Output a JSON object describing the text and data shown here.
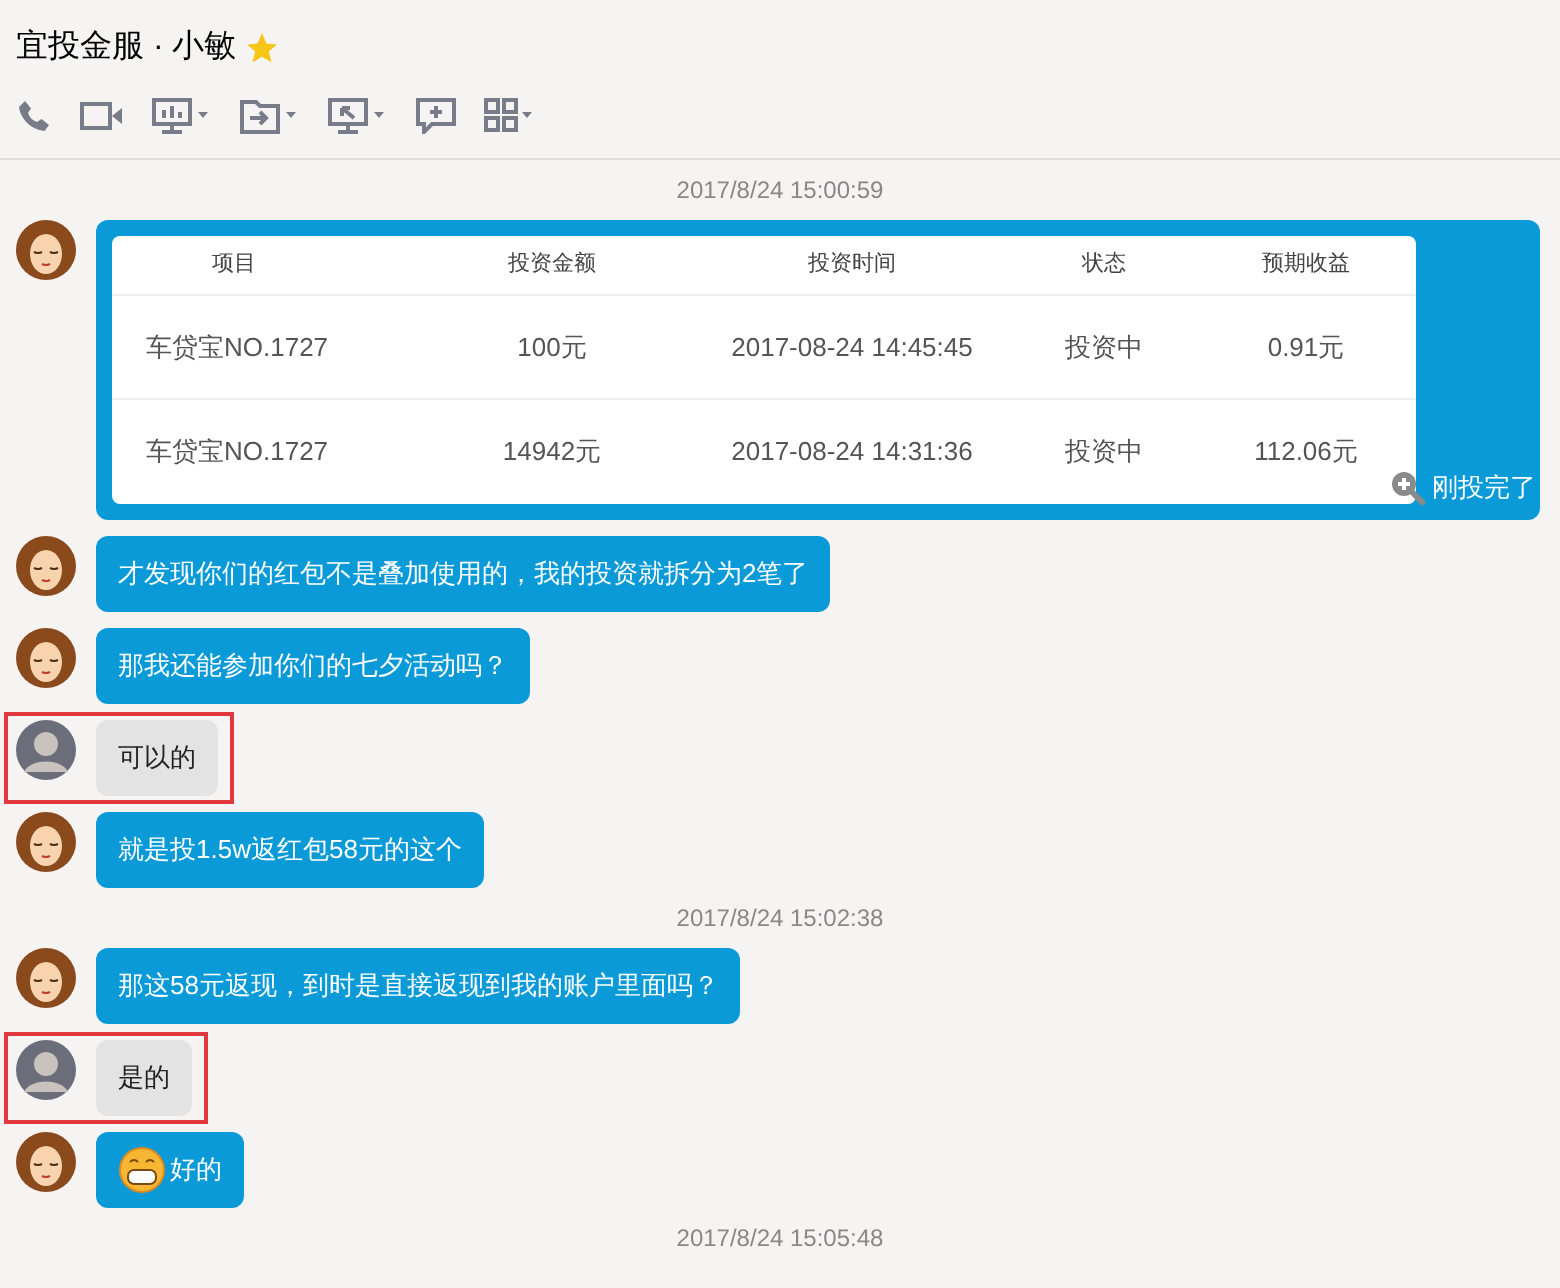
{
  "window": {
    "title": "宜投金服 · 小敏"
  },
  "messages": [
    {
      "kind": "timestamp",
      "text": "2017/8/24 15:00:59"
    },
    {
      "kind": "table",
      "columns": [
        "项目",
        "投资金额",
        "投资时间",
        "状态",
        "预期收益"
      ],
      "rows": [
        [
          "车贷宝NO.1727",
          "100元",
          "2017-08-24 14:45:45",
          "投资中",
          "0.91元"
        ],
        [
          "车贷宝NO.1727",
          "14942元",
          "2017-08-24 14:31:36",
          "投资中",
          "112.06元"
        ]
      ],
      "caption": "刚投完了"
    },
    {
      "kind": "sent",
      "highlighted": false,
      "text": "才发现你们的红包不是叠加使用的，我的投资就拆分为2笔了"
    },
    {
      "kind": "sent",
      "highlighted": false,
      "text": "那我还能参加你们的七夕活动吗？"
    },
    {
      "kind": "received",
      "highlighted": true,
      "text": "可以的"
    },
    {
      "kind": "sent",
      "highlighted": false,
      "text": "就是投1.5w返红包58元的这个"
    },
    {
      "kind": "timestamp",
      "text": "2017/8/24 15:02:38"
    },
    {
      "kind": "sent",
      "highlighted": false,
      "text": "那这58元返现，到时是直接返现到我的账户里面吗？"
    },
    {
      "kind": "received",
      "highlighted": true,
      "text": "是的"
    },
    {
      "kind": "sent_emoji",
      "highlighted": false,
      "text": "好的"
    },
    {
      "kind": "timestamp",
      "text": "2017/8/24 15:05:48"
    }
  ]
}
